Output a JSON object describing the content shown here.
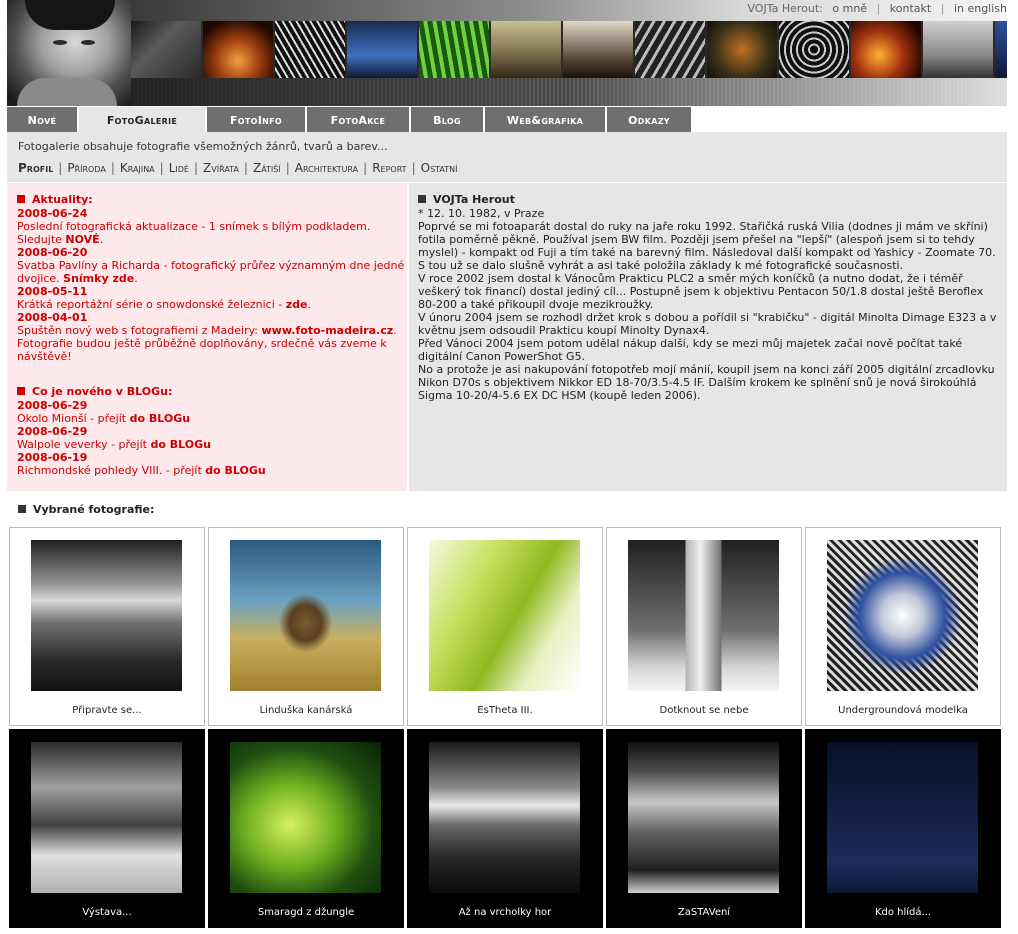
{
  "header": {
    "owner": "VOJTa Herout:",
    "links": [
      "o mně",
      "kontakt",
      "in english"
    ]
  },
  "nav": {
    "tabs": [
      "Nové",
      "FotoGalerie",
      "FotoInfo",
      "FotoAkce",
      "Blog",
      "Web&grafika",
      "Odkazy"
    ],
    "active": "FotoGalerie"
  },
  "intro": {
    "text": "Fotogalerie obsahuje fotografie všemožných žánrů, tvarů a barev...",
    "categories": [
      "Profil",
      "Příroda",
      "Krajina",
      "Lidé",
      "Zvířata",
      "Zátiší",
      "Architektura",
      "Report",
      "Ostatní"
    ],
    "active_category": "Profil"
  },
  "news": {
    "heading": "Aktuality:",
    "items": [
      {
        "date": "2008-06-24",
        "text": "Poslední fotografická aktualizace - 1 snímek s bílým podkladem. Sledujte ",
        "link": "NOVÉ",
        "after": "."
      },
      {
        "date": "2008-06-20",
        "text": "Svatba Pavlíny a Richarda - fotografický průřez významným dne jedné dvojice. ",
        "link": "Snímky zde",
        "after": "."
      },
      {
        "date": "2008-05-11",
        "text": "Krátká reportážní série o snowdonské železnici - ",
        "link": "zde",
        "after": "."
      },
      {
        "date": "2008-04-01",
        "text": "Spuštěn nový web s fotografiemi z Madeiry: ",
        "link": "www.foto-madeira.cz",
        "after": ". Fotografie budou ještě průběžně doplňovány, srdečně vás zveme k návštěvě!"
      }
    ]
  },
  "blog": {
    "heading": "Co je nového v BLOGu:",
    "items": [
      {
        "date": "2008-06-29",
        "text": "Okolo Mionší - přejít ",
        "link": "do BLOGu"
      },
      {
        "date": "2008-06-29",
        "text": "Walpole veverky - přejít ",
        "link": "do BLOGu"
      },
      {
        "date": "2008-06-19",
        "text": "Richmondské pohledy VIII. - přejít ",
        "link": "do BLOGu"
      }
    ]
  },
  "bio": {
    "title": "VOJTa Herout",
    "paragraphs": [
      "* 12. 10. 1982, v Praze",
      "Poprvé se mi fotoaparát dostal do ruky na jaře roku 1992. Stařičká ruská Vilia (dodnes ji mám ve skříni) fotila poměrně pěkně. Používal jsem BW film. Později jsem přešel na \"lepší\" (alespoň jsem si to tehdy myslel) - kompakt od Fuji a tím také na barevný film. Následoval další kompakt od Yashicy - Zoomate 70. S tou už se dalo slušně vyhrát a asi také položila základy k mé fotografické současnosti.",
      "V roce 2002 jsem dostal k Vánocům Prakticu PLC2 a směr mých koníčků (a nutno dodat, že i téměř veškerý tok financí) dostal jediný cíl... Postupně jsem k objektivu Pentacon 50/1.8 dostal ještě Beroflex 80-200 a také přikoupil dvoje mezikroužky.",
      "V únoru 2004 jsem se rozhodl držet krok s dobou a pořídil si \"krabičku\" - digitál Minolta Dimage E323 a v květnu jsem odsoudil Prakticu koupí Minolty Dynax4.",
      "Před Vánoci 2004 jsem potom udělal nákup další, kdy se mezi můj majetek začal nově počítat také digitální Canon PowerShot G5.",
      "No a protože je asi nakupování fotopotřeb mojí mánií, koupil jsem na konci září 2005 digitální zrcadlovku Nikon D70s s objektivem Nikkor ED 18-70/3.5-4.5 IF. Dalším krokem ke splnění snů je nová širokoúhlá Sigma 10-20/4-5.6 EX DC HSM (koupě leden 2006)."
    ]
  },
  "gallery": {
    "title": "Vybrané fotografie:",
    "photos": [
      {
        "caption": "Připravte se..."
      },
      {
        "caption": "Linduška kanárská"
      },
      {
        "caption": "EsTheta III."
      },
      {
        "caption": "Dotknout se nebe"
      },
      {
        "caption": "Undergroundová modelka"
      },
      {
        "caption": "Výstava..."
      },
      {
        "caption": "Smaragd z džungle"
      },
      {
        "caption": "Až na vrcholky hor"
      },
      {
        "caption": "ZaSTAVení"
      },
      {
        "caption": "Kdo hlídá..."
      }
    ]
  }
}
